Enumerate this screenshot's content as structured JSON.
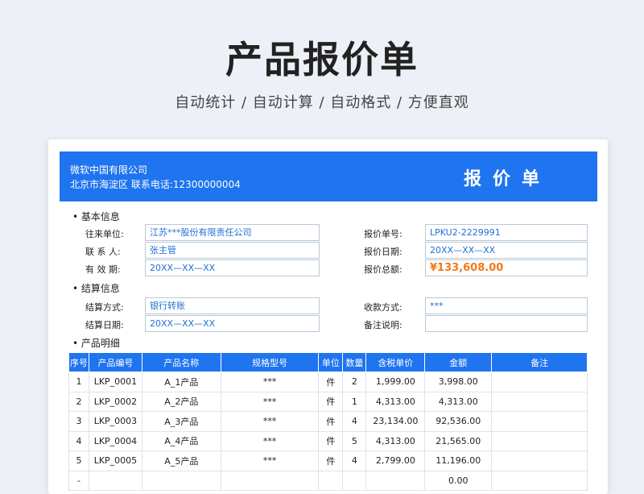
{
  "header": {
    "title": "产品报价单",
    "subtitle": "自动统计 / 自动计算 / 自动格式 / 方便直观"
  },
  "banner": {
    "company": "微软中国有限公司",
    "address": "北京市海淀区 联系电话:12300000004",
    "doc_title": "报价单"
  },
  "basic_info": {
    "section_label": "基本信息",
    "partner_label": "往来单位:",
    "partner_value": "江苏***股份有限责任公司",
    "contact_label": "联 系 人:",
    "contact_value": "张主管",
    "valid_label": "有 效 期:",
    "valid_value": "20XX—XX—XX",
    "quote_no_label": "报价单号:",
    "quote_no_value": "LPKU2-2229991",
    "quote_date_label": "报价日期:",
    "quote_date_value": "20XX—XX—XX",
    "total_label": "报价总额:",
    "total_value": "¥133,608.00"
  },
  "settlement": {
    "section_label": "结算信息",
    "method_label": "结算方式:",
    "method_value": "银行转账",
    "date_label": "结算日期:",
    "date_value": "20XX—XX—XX",
    "receipt_label": "收款方式:",
    "receipt_value": "***",
    "note_label": "备注说明:",
    "note_value": ""
  },
  "products": {
    "section_label": "产品明细",
    "columns": [
      "序号",
      "产品编号",
      "产品名称",
      "规格型号",
      "单位",
      "数量",
      "含税单价",
      "金额",
      "备注"
    ],
    "rows": [
      [
        "1",
        "LKP_0001",
        "A_1产品",
        "***",
        "件",
        "2",
        "1,999.00",
        "3,998.00",
        ""
      ],
      [
        "2",
        "LKP_0002",
        "A_2产品",
        "***",
        "件",
        "1",
        "4,313.00",
        "4,313.00",
        ""
      ],
      [
        "3",
        "LKP_0003",
        "A_3产品",
        "***",
        "件",
        "4",
        "23,134.00",
        "92,536.00",
        ""
      ],
      [
        "4",
        "LKP_0004",
        "A_4产品",
        "***",
        "件",
        "5",
        "4,313.00",
        "21,565.00",
        ""
      ],
      [
        "5",
        "LKP_0005",
        "A_5产品",
        "***",
        "件",
        "4",
        "2,799.00",
        "11,196.00",
        ""
      ],
      [
        "-",
        "",
        "",
        "",
        "",
        "",
        "",
        "0.00",
        ""
      ]
    ]
  }
}
